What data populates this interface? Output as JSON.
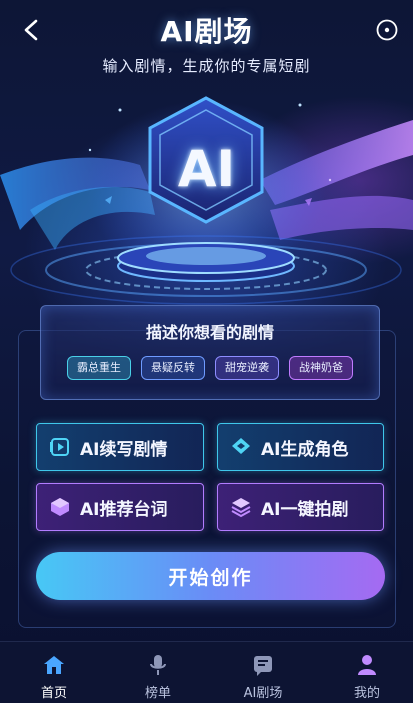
{
  "header": {
    "title": "AI剧场",
    "subtitle": "输入剧情，生成你的专属短剧",
    "back_icon": "chevron-left-icon",
    "menu_icon": "circle-dot-icon"
  },
  "hero": {
    "badge_text": "AI"
  },
  "prompt": {
    "title": "描述你想看的剧情",
    "tags": [
      "霸总重生",
      "悬疑反转",
      "甜宠逆袭",
      "战神奶爸"
    ]
  },
  "features": [
    {
      "label": "AI续写剧情",
      "icon": "play-doc-icon",
      "style": "cyan"
    },
    {
      "label": "AI生成角色",
      "icon": "layers-icon",
      "style": "cyan"
    },
    {
      "label": "AI推荐台词",
      "icon": "cube-icon",
      "style": "purple"
    },
    {
      "label": "AI一键拍剧",
      "icon": "stack-icon",
      "style": "purple"
    }
  ],
  "start_button": {
    "label": "开始创作"
  },
  "nav": {
    "items": [
      {
        "label": "首页",
        "icon": "home-icon",
        "active": true
      },
      {
        "label": "榜单",
        "icon": "microphone-icon",
        "active": false
      },
      {
        "label": "AI剧场",
        "icon": "document-icon",
        "active": false
      },
      {
        "label": "我的",
        "icon": "user-icon",
        "active": false
      }
    ]
  },
  "colors": {
    "accent_cyan": "#3fc7ea",
    "accent_purple": "#b27cff",
    "nav_active": "#4aa6ff",
    "background": "#0d1636"
  }
}
